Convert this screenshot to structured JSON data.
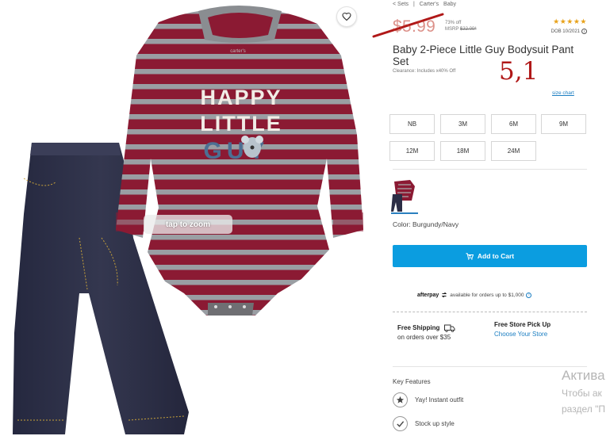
{
  "breadcrumb": [
    "< Sets",
    "|",
    "Carter's",
    "Baby"
  ],
  "price": {
    "sale": "$5.99",
    "percent_off": "73% off",
    "msrp_label": "MSRP",
    "msrp_value": "$22.00*"
  },
  "rating": {
    "stars": "★★★★★",
    "dob": "DOB 10/2021"
  },
  "product": {
    "title": "Baby 2-Piece Little Guy Bodysuit Pant Set",
    "clearance": "Clearance: Includes x40% Off"
  },
  "annotation": {
    "handwritten": "5,1"
  },
  "size_chart": "size chart",
  "sizes": [
    "NB",
    "3M",
    "6M",
    "9M",
    "12M",
    "18M",
    "24M"
  ],
  "color": {
    "label": "Color: Burgundy/Navy"
  },
  "add_to_cart": "Add to Cart",
  "afterpay": {
    "brand": "afterpay",
    "text": "available for orders up to $1,000"
  },
  "shipping": {
    "title": "Free Shipping",
    "detail": "on orders over $35"
  },
  "pickup": {
    "title": "Free Store Pick Up",
    "link": "Choose Your Store"
  },
  "key_features": {
    "heading": "Key Features",
    "items": [
      "Yay! Instant outfit",
      "Stock up style"
    ]
  },
  "image": {
    "zoom_label": "tap to zoom",
    "print_lines": [
      "HAPPY",
      "LITTLE",
      "GUY"
    ],
    "collar_tag": "carter's"
  },
  "watermark": {
    "line1": "Актива",
    "line2": "Чтобы ак",
    "line3": "раздел \"П"
  },
  "colors": {
    "burgundy": "#8b1a33",
    "stripe_gray": "#9a9ea3",
    "denim": "#2b2d45",
    "accent_blue": "#0b9de0",
    "star_gold": "#e8a21a"
  }
}
